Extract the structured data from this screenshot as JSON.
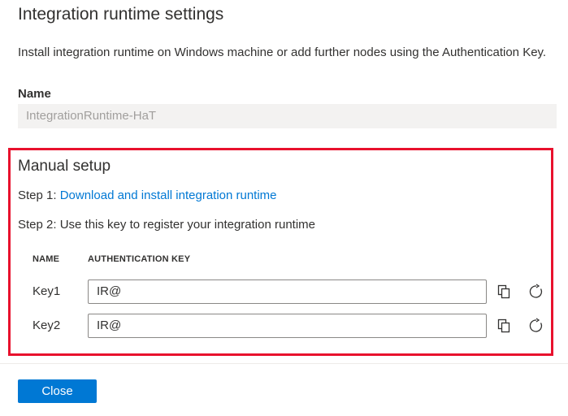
{
  "panel": {
    "title": "Integration runtime settings",
    "description": "Install integration runtime on Windows machine or add further nodes using the Authentication Key.",
    "name_label": "Name",
    "name_value": "IntegrationRuntime-HaT"
  },
  "manual_setup": {
    "title": "Manual setup",
    "step1_prefix": "Step 1: ",
    "step1_link": "Download and install integration runtime",
    "step2": "Step 2: Use this key to register your integration runtime",
    "columns": {
      "name": "NAME",
      "key": "AUTHENTICATION KEY"
    },
    "keys": [
      {
        "name": "Key1",
        "value": "IR@"
      },
      {
        "name": "Key2",
        "value": "IR@"
      }
    ],
    "highlight_color": "#e8112d"
  },
  "footer": {
    "close_label": "Close"
  },
  "colors": {
    "accent": "#0078d4"
  },
  "icons": {
    "copy": "copy-icon",
    "refresh": "refresh-icon"
  }
}
